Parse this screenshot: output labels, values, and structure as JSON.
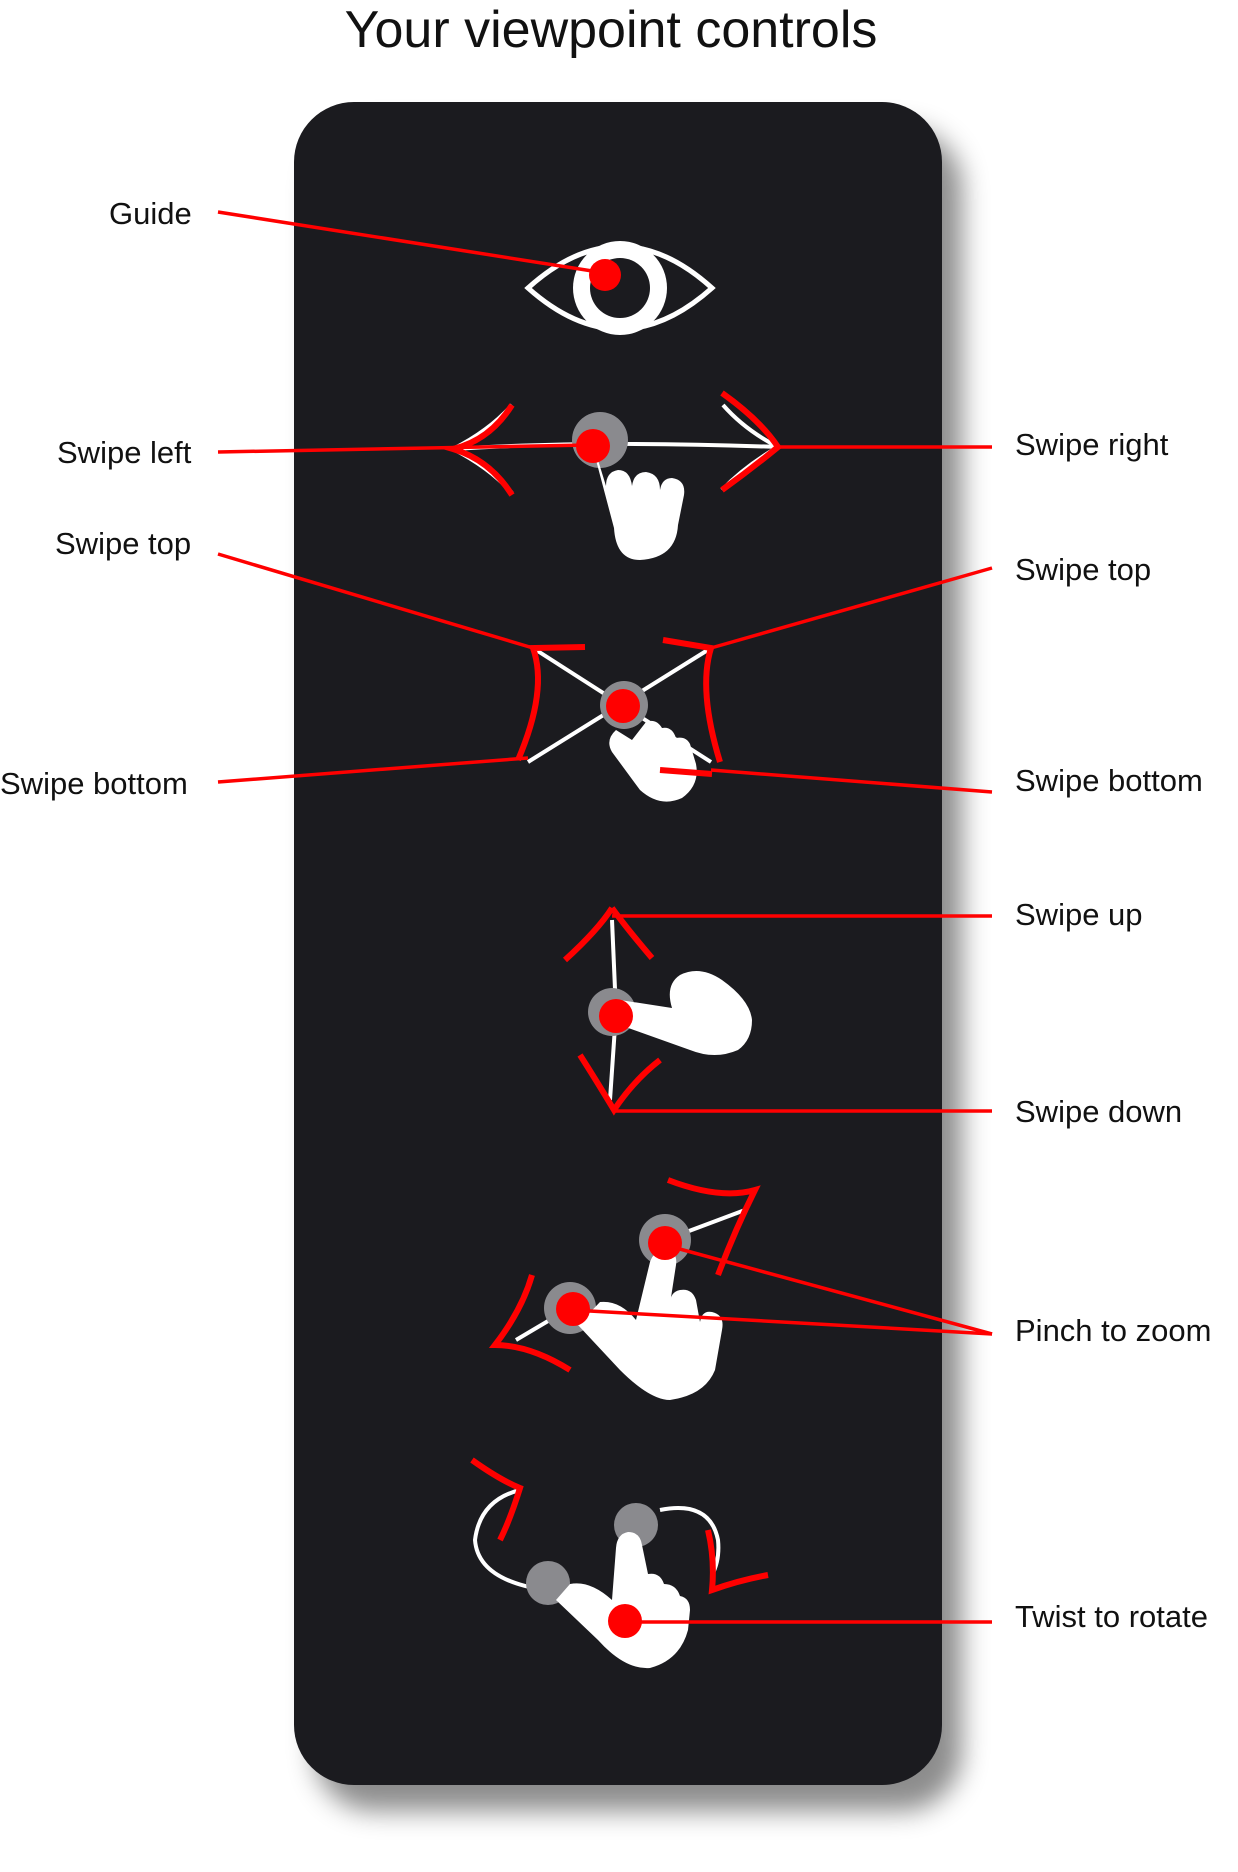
{
  "title": "Your viewpoint controls",
  "colors": {
    "panel": "#1b1b1f",
    "callout": "#ff0000",
    "icon": "#ffffff",
    "touch_ring": "#8a8a8e",
    "text": "#111111"
  },
  "labels": {
    "guide": "Guide",
    "swipe_left": "Swipe left",
    "swipe_right": "Swipe right",
    "swipe_top_left": "Swipe top",
    "swipe_top_right": "Swipe top",
    "swipe_bottom_left": "Swipe bottom",
    "swipe_bottom_right": "Swipe bottom",
    "swipe_up": "Swipe up",
    "swipe_down": "Swipe down",
    "pinch_to_zoom": "Pinch to zoom",
    "twist_to_rotate": "Twist to rotate"
  },
  "icons": [
    "eye-icon",
    "swipe-horizontal-icon",
    "swipe-diagonal-icon",
    "swipe-vertical-icon",
    "pinch-icon",
    "rotate-icon"
  ]
}
